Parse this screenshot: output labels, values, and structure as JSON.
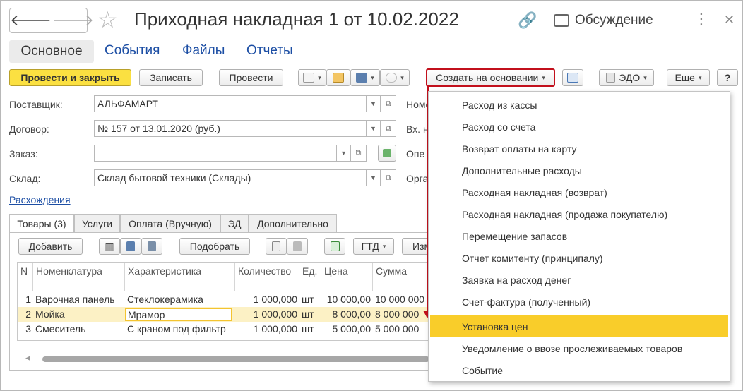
{
  "window": {
    "title": "Приходная накладная 1 от 10.02.2022",
    "discussion_label": "Обсуждение"
  },
  "section_tabs": [
    "Основное",
    "События",
    "Файлы",
    "Отчеты"
  ],
  "toolbar": {
    "post_close": "Провести и закрыть",
    "save": "Записать",
    "post": "Провести",
    "create_based": "Создать на основании",
    "edo": "ЭДО",
    "more": "Еще",
    "help": "?"
  },
  "form": {
    "supplier_label": "Поставщик:",
    "supplier_value": "АЛЬФАМАРТ",
    "contract_label": "Договор:",
    "contract_value": "№ 157 от 13.01.2020 (руб.)",
    "order_label": "Заказ:",
    "order_value": "",
    "warehouse_label": "Склад:",
    "warehouse_value": "Склад бытовой техники (Склады)",
    "right_label_1": "Номе",
    "right_label_2": "Вх. н",
    "right_label_3": "Опе",
    "right_label_4": "Орга",
    "discrepancies_link": "Расхождения"
  },
  "inner_tabs": [
    "Товары (3)",
    "Услуги",
    "Оплата (Вручную)",
    "ЭД",
    "Дополнительно"
  ],
  "items_toolbar": {
    "add": "Добавить",
    "pick": "Подобрать",
    "gtd": "ГТД",
    "change": "Изм"
  },
  "grid": {
    "headers": [
      "N",
      "Номенклатура",
      "Характеристика",
      "Количество",
      "Ед.",
      "Цена",
      "Сумма"
    ],
    "rows": [
      {
        "n": "1",
        "name": "Варочная панель",
        "char": "Стеклокерамика",
        "qty": "1 000,000",
        "unit": "шт",
        "price": "10 000,00",
        "sum": "10 000 000"
      },
      {
        "n": "2",
        "name": "Мойка",
        "char": "Мрамор",
        "qty": "1 000,000",
        "unit": "шт",
        "price": "8 000,00",
        "sum": "8 000 000"
      },
      {
        "n": "3",
        "name": "Смеситель",
        "char": "С краном под фильтр",
        "qty": "1 000,000",
        "unit": "шт",
        "price": "5 000,00",
        "sum": "5 000 000"
      }
    ]
  },
  "menu": {
    "items": [
      "Расход из кассы",
      "Расход со счета",
      "Возврат оплаты на карту",
      "Дополнительные расходы",
      "Расходная накладная (возврат)",
      "Расходная накладная (продажа покупателю)",
      "Перемещение запасов",
      "Отчет комитенту (принципалу)",
      "Заявка на расход денег",
      "Счет-фактура (полученный)",
      "Установка цен",
      "Уведомление о ввозе прослеживаемых товаров",
      "Событие"
    ],
    "highlighted": "Установка цен"
  },
  "colors": {
    "accent_yellow": "#fbe041",
    "highlight_yellow": "#f9cd2a",
    "annotation_red": "#c2101c",
    "link_blue": "#1c4ea4"
  }
}
